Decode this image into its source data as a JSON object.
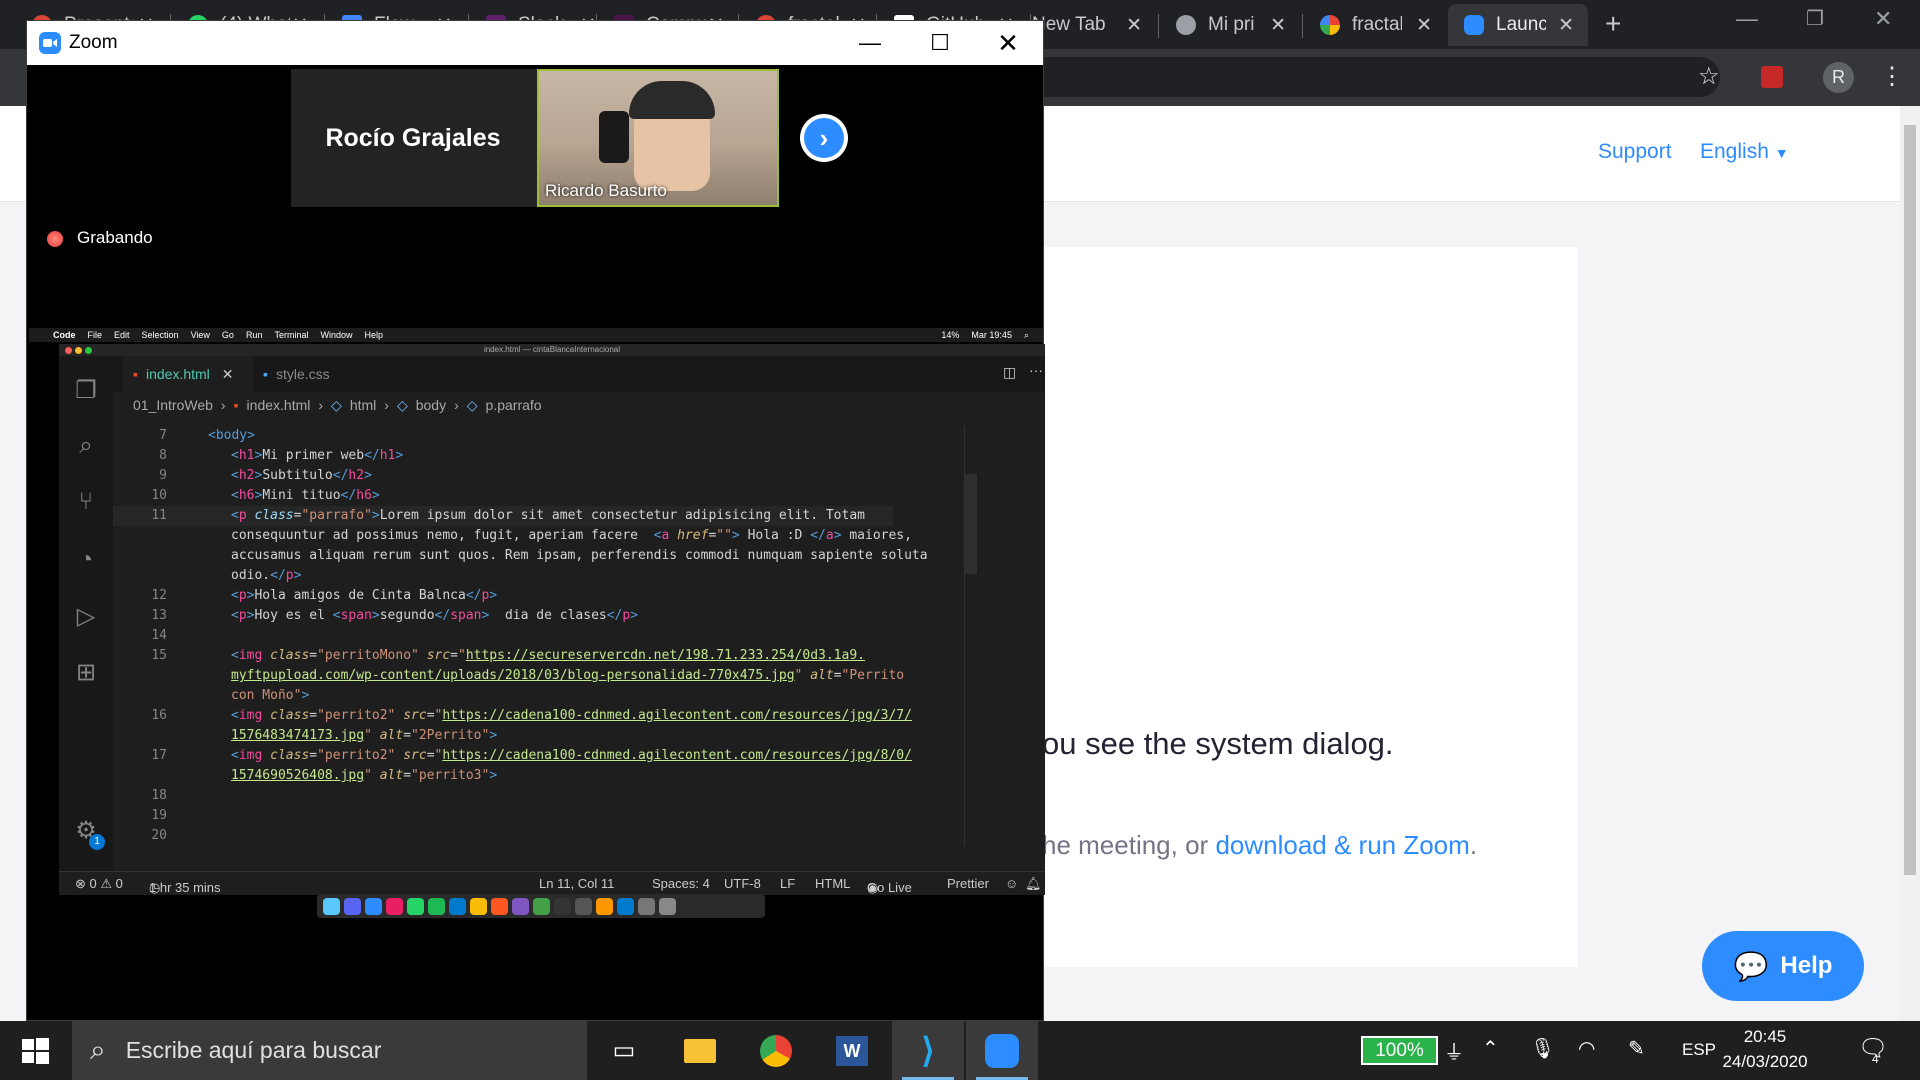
{
  "browser": {
    "tabs": [
      {
        "title": "Presente",
        "icon": "red-app-icon",
        "color": "#db4437"
      },
      {
        "title": "(4) WhatsApp",
        "icon": "whatsapp-icon",
        "color": "#25d366"
      },
      {
        "title": "Flow",
        "icon": "flow-icon",
        "color": "#4285f4"
      },
      {
        "title": "Slack",
        "icon": "slack-icon",
        "color": "#611f69"
      },
      {
        "title": "Campus",
        "icon": "campus-icon",
        "color": "#4a154b"
      },
      {
        "title": "fractal",
        "icon": "red-circle-icon",
        "color": "#db4437"
      },
      {
        "title": "GitHub",
        "icon": "github-icon",
        "color": "#ffffff"
      },
      {
        "title": "New Tab",
        "icon": "",
        "color": ""
      },
      {
        "title": "Mi pri",
        "icon": "globe-icon",
        "color": "#9aa0a6"
      },
      {
        "title": "fractal",
        "icon": "google-icon",
        "color": "#4285f4"
      },
      {
        "title": "Launc",
        "icon": "zoom-icon",
        "color": "#2d8cff"
      }
    ],
    "new_tab_symbol": "+",
    "profile_initial": "R"
  },
  "zoom_page": {
    "support": "Support",
    "language": "English",
    "line1": "ou see the system dialog.",
    "line2_prefix": "he meeting, or ",
    "line2_link": "download & run Zoom",
    "line2_suffix": ".",
    "help": "Help"
  },
  "zoom_window": {
    "title": "Zoom",
    "participant_name": "Rocío Grajales",
    "video_name": "Ricardo Basurto",
    "recording": "Grabando"
  },
  "mac_menubar": {
    "items": [
      "Code",
      "File",
      "Edit",
      "Selection",
      "View",
      "Go",
      "Run",
      "Terminal",
      "Window",
      "Help"
    ],
    "battery": "14%",
    "time": "Mar 19:45"
  },
  "vscode": {
    "window_title": "index.html — cintaBlancaInternacional",
    "tabs": [
      {
        "label": "index.html"
      },
      {
        "label": "style.css"
      }
    ],
    "breadcrumb": [
      "01_IntroWeb",
      "index.html",
      "html",
      "body",
      "p.parrafo"
    ],
    "status": {
      "problems": "⊗ 0 ⚠ 0",
      "timer": "1 hr 35 mins",
      "position": "Ln 11, Col 11",
      "spaces": "Spaces: 4",
      "encoding": "UTF-8",
      "eol": "LF",
      "language": "HTML",
      "golive": "Go Live",
      "prettier": "Prettier"
    },
    "badge": "1"
  },
  "taskbar": {
    "search_placeholder": "Escribe aquí para buscar",
    "battery": "100%",
    "lang": "ESP",
    "time": "20:45",
    "date": "24/03/2020",
    "notifications": "4"
  }
}
